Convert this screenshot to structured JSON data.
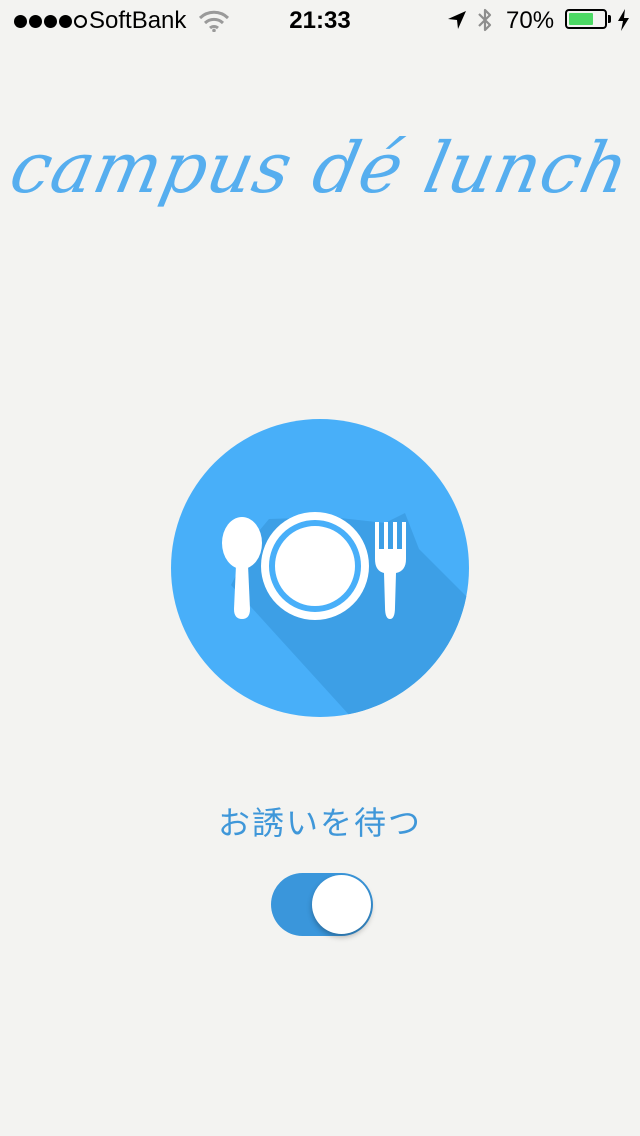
{
  "status_bar": {
    "carrier": "SoftBank",
    "time": "21:33",
    "battery_percent": "70%",
    "battery_level": 0.7,
    "signal_bars_on": 4,
    "signal_bars_total": 5,
    "icons": [
      "wifi-icon",
      "location-arrow-icon",
      "bluetooth-icon",
      "battery-icon",
      "charging-bolt-icon"
    ]
  },
  "app": {
    "logo_text": "campus dé lunch",
    "emblem_icon": "plate-spoon-fork-icon",
    "wait_label": "お誘いを待つ",
    "toggle_on": true
  },
  "colors": {
    "background": "#f3f3f1",
    "accent": "#48aff9",
    "logo": "#56aeef",
    "label": "#3f97d9",
    "toggle": "#3a96db",
    "battery_fill": "#4cd964"
  }
}
